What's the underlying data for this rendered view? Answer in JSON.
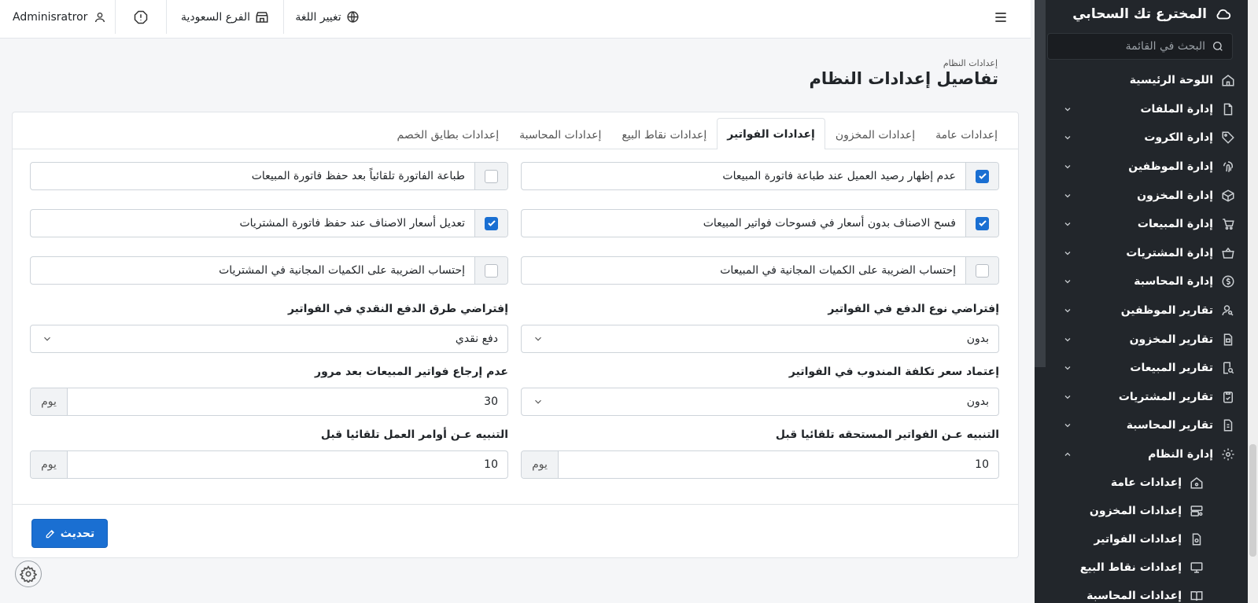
{
  "topbar": {
    "user_name": "Adminisratror",
    "branch": "الفرع السعودية",
    "language": "تغيير اللغة"
  },
  "sidebar": {
    "brand": "المخترع تك السحابي",
    "search_placeholder": "البحث في القائمة",
    "items": [
      {
        "label": "اللوحة الرئيسية",
        "icon": "home-icon"
      },
      {
        "label": "إدارة الملفات",
        "icon": "file-icon"
      },
      {
        "label": "إدارة الكروت",
        "icon": "tag-icon"
      },
      {
        "label": "إدارة الموظفين",
        "icon": "fingerprint-icon"
      },
      {
        "label": "إدارة المخزون",
        "icon": "box-icon"
      },
      {
        "label": "إدارة المبيعات",
        "icon": "cart-icon"
      },
      {
        "label": "إدارة المشتريات",
        "icon": "basket-icon"
      },
      {
        "label": "إدارة المحاسبة",
        "icon": "dollar-icon"
      },
      {
        "label": "تقارير الموظفين",
        "icon": "user-search-icon"
      },
      {
        "label": "تقارير المخزون",
        "icon": "file-report-icon"
      },
      {
        "label": "تقارير المبيعات",
        "icon": "receipt-search-icon"
      },
      {
        "label": "تقارير المشتريات",
        "icon": "clipboard-icon"
      },
      {
        "label": "تقارير المحاسبة",
        "icon": "invoice-icon"
      },
      {
        "label": "إدارة النظام",
        "icon": "gear-icon"
      }
    ],
    "sub_items": [
      {
        "label": "إعدادات عامة",
        "icon": "home-gear-icon"
      },
      {
        "label": "إعدادات المخزون",
        "icon": "server-gear-icon"
      },
      {
        "label": "إعدادات الفواتير",
        "icon": "file-gear-icon"
      },
      {
        "label": "إعدادات نقاط البيع",
        "icon": "monitor-gear-icon"
      },
      {
        "label": "إعدادات المحاسبة",
        "icon": "book-icon"
      }
    ]
  },
  "page": {
    "breadcrumb": "إعدادات النظام",
    "title": "تفاصيل إعدادات النظام"
  },
  "tabs": [
    "إعدادات عامة",
    "إعدادات المخزون",
    "إعدادات الفواتير",
    "إعدادات نقاط البيع",
    "إعدادات المحاسبة",
    "إعدادات بطايق الخصم"
  ],
  "active_tab": "إعدادات الفواتير",
  "checkboxes": [
    {
      "label": "عدم إظهار رصيد العميل عند طباعة فاتورة المبيعات",
      "checked": true
    },
    {
      "label": "طباعة الفاتورة تلقائياً بعد حفظ فاتورة المبيعات",
      "checked": false
    },
    {
      "label": "فسح الاصناف بدون أسعار في فسوحات فواتير المبيعات",
      "checked": true
    },
    {
      "label": "تعديل أسعار الاصناف عند حفظ فاتورة المشتريات",
      "checked": true
    },
    {
      "label": "إحتساب الضريبة على الكميات المجانية في المبيعات",
      "checked": false
    },
    {
      "label": "إحتساب الضريبة على الكميات المجانية في المشتريات",
      "checked": false
    }
  ],
  "fields": {
    "payment_type_label": "إفتراضي نوع الدفع في الفواتير",
    "payment_type_value": "بدون",
    "cash_method_label": "إفتراضي طرق الدفع النقدي في الفواتير",
    "cash_method_value": "دفع نقدي",
    "rep_cost_label": "إعتماد سعر تكلفة المندوب في الفواتير",
    "rep_cost_value": "بدون",
    "no_return_label": "عدم إرجاع فواتير المبيعات بعد مرور",
    "no_return_value": "30",
    "due_alert_label": "التنبيه عـن الفواتير المستحقه تلقائيا قبل",
    "due_alert_value": "10",
    "work_order_label": "التنبيه عـن أوامر العمل تلقائيا قبل",
    "work_order_value": "10",
    "unit": "يوم"
  },
  "buttons": {
    "update": "تحديث"
  },
  "colors": {
    "primary": "#1a6fd2",
    "sidebar_bg": "#22262b"
  }
}
